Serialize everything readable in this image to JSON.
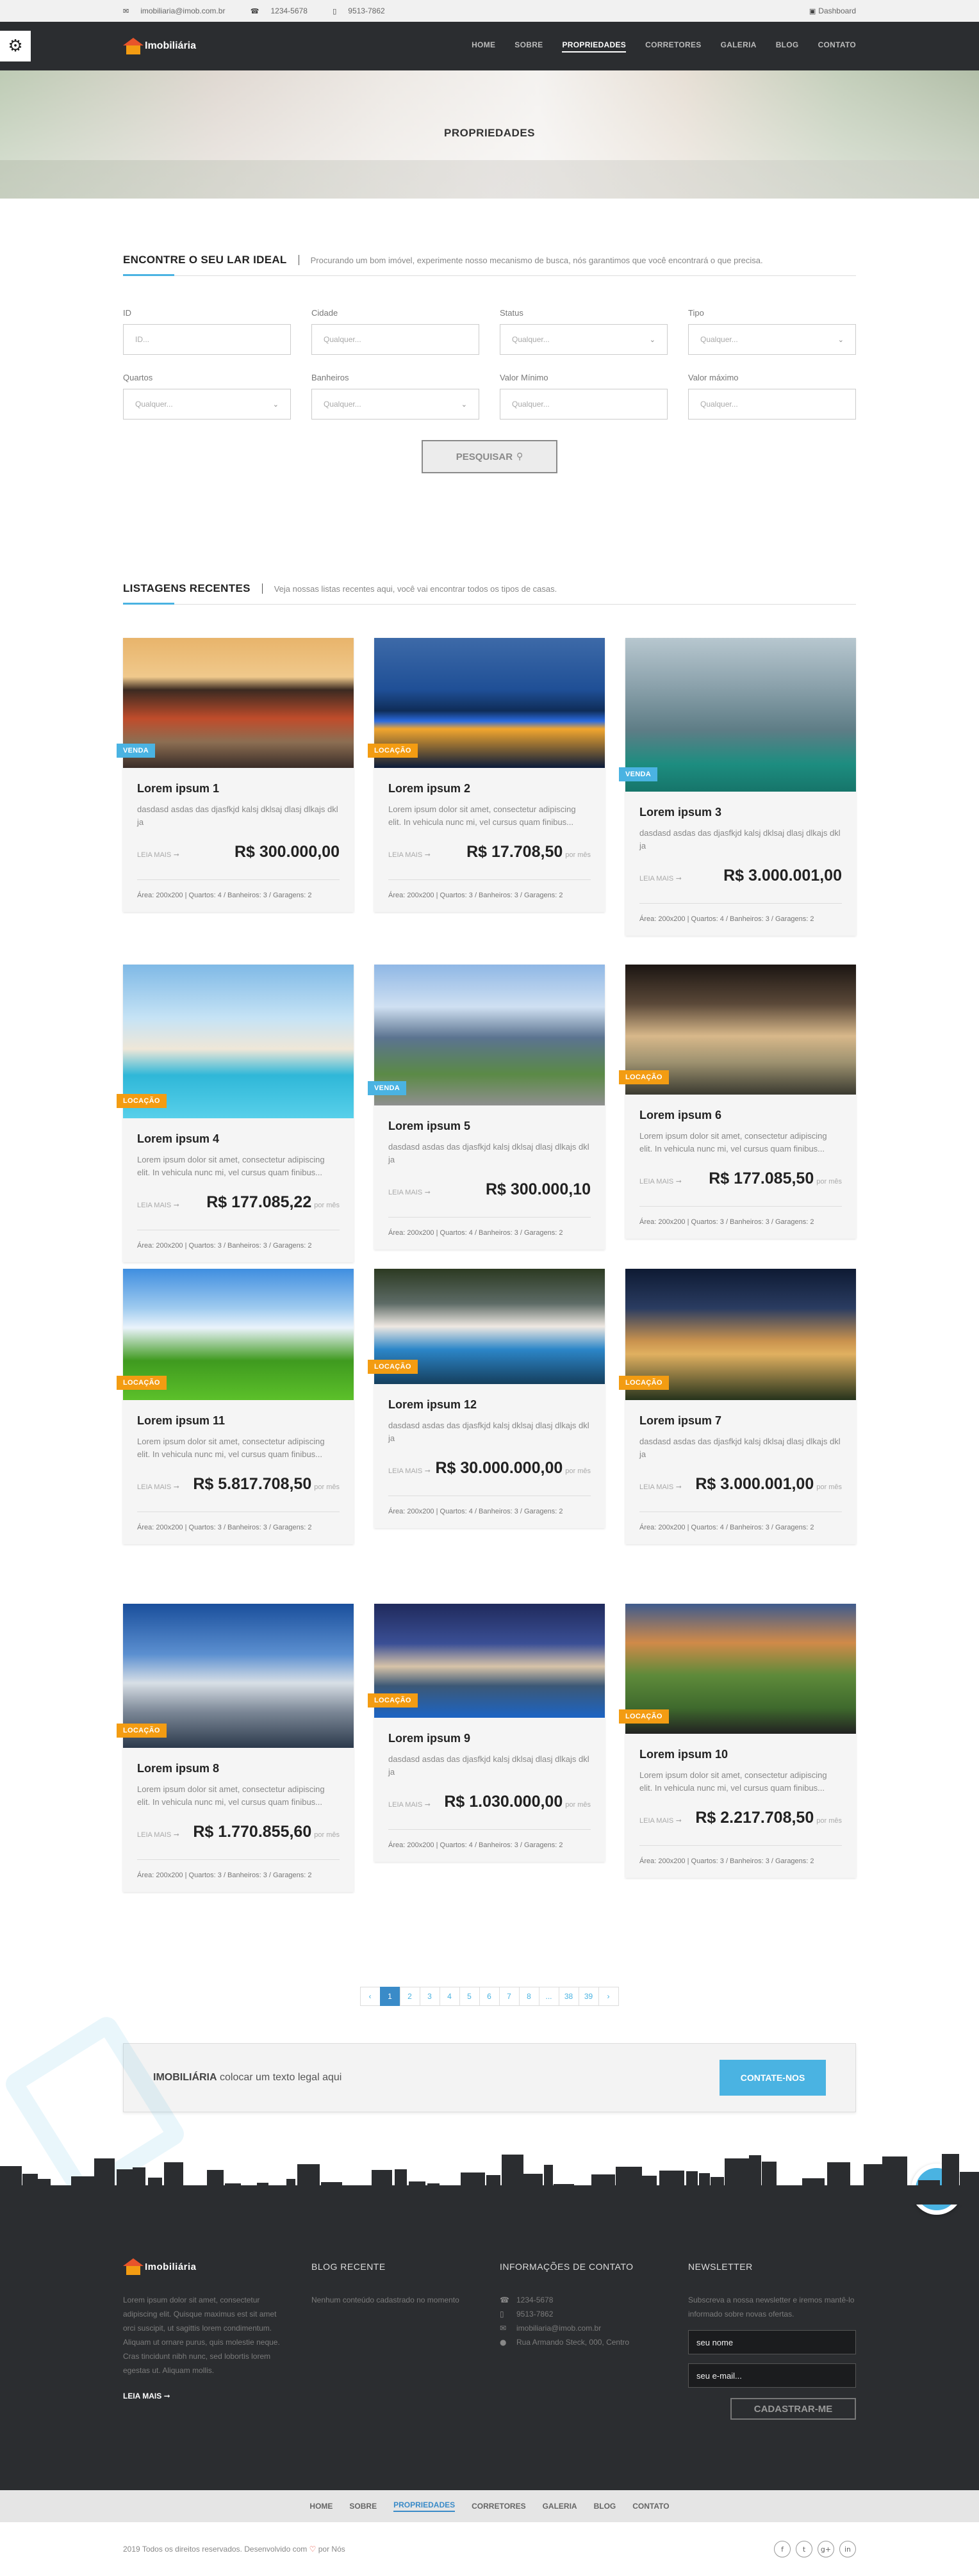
{
  "topbar": {
    "email": "imobiliaria@imob.com.br",
    "phone1": "1234-5678",
    "phone2": "9513-7862",
    "dashboard": "Dashboard"
  },
  "brand": {
    "name": "Imobiliária"
  },
  "nav": {
    "items": [
      "HOME",
      "SOBRE",
      "PROPRIEDADES",
      "CORRETORES",
      "GALERIA",
      "BLOG",
      "CONTATO"
    ],
    "active": "PROPRIEDADES"
  },
  "banner": {
    "title": "PROPRIEDADES"
  },
  "search": {
    "title": "ENCONTRE O SEU LAR IDEAL",
    "subtitle": "Procurando um bom imóvel, experimente nosso mecanismo de busca, nós garantimos que você encontrará o que precisa.",
    "fields": [
      {
        "label": "ID",
        "placeholder": "ID...",
        "select": false
      },
      {
        "label": "Cidade",
        "placeholder": "Qualquer...",
        "select": false
      },
      {
        "label": "Status",
        "placeholder": "Qualquer...",
        "select": true
      },
      {
        "label": "Tipo",
        "placeholder": "Qualquer...",
        "select": true
      },
      {
        "label": "Quartos",
        "placeholder": "Qualquer...",
        "select": true
      },
      {
        "label": "Banheiros",
        "placeholder": "Qualquer...",
        "select": true
      },
      {
        "label": "Valor Mínimo",
        "placeholder": "Qualquer...",
        "select": false
      },
      {
        "label": "Valor máximo",
        "placeholder": "Qualquer...",
        "select": false
      }
    ],
    "button": "PESQUISAR"
  },
  "listings": {
    "title": "LISTAGENS RECENTES",
    "subtitle": "Veja nossas listas recentes aqui, você vai encontrar todos os tipos de casas.",
    "read_more": "LEIA MAIS",
    "per_month": "por mês",
    "cards": [
      {
        "title": "Lorem ipsum 1",
        "badge": "VENDA",
        "desc": "dasdasd asdas das djasfkjd kalsj dklsaj dlasj dlkajs dkl ja",
        "price": "R$ 300.000,00",
        "monthly": false,
        "meta": "Área: 200x200  |  Quartos: 4  /  Banheiros: 3  /  Garagens: 2"
      },
      {
        "title": "Lorem ipsum 2",
        "badge": "LOCAÇÃO",
        "desc": "Lorem ipsum dolor sit amet, consectetur adipiscing elit. In vehicula nunc mi, vel cursus quam finibus...",
        "price": "R$ 17.708,50",
        "monthly": true,
        "meta": "Área: 200x200  |  Quartos: 3  /  Banheiros: 3  /  Garagens: 2"
      },
      {
        "title": "Lorem ipsum 3",
        "badge": "VENDA",
        "desc": "dasdasd asdas das djasfkjd kalsj dklsaj dlasj dlkajs dkl ja",
        "price": "R$ 3.000.001,00",
        "monthly": false,
        "meta": "Área: 200x200  |  Quartos: 4  /  Banheiros: 3  /  Garagens: 2"
      },
      {
        "title": "Lorem ipsum 4",
        "badge": "LOCAÇÃO",
        "desc": "Lorem ipsum dolor sit amet, consectetur adipiscing elit. In vehicula nunc mi, vel cursus quam finibus...",
        "price": "R$ 177.085,22",
        "monthly": true,
        "meta": "Área: 200x200  |  Quartos: 3  /  Banheiros: 3  /  Garagens: 2"
      },
      {
        "title": "Lorem ipsum 5",
        "badge": "VENDA",
        "desc": "dasdasd asdas das djasfkjd kalsj dklsaj dlasj dlkajs dkl ja",
        "price": "R$ 300.000,10",
        "monthly": false,
        "meta": "Área: 200x200  |  Quartos: 4  /  Banheiros: 3  /  Garagens: 2"
      },
      {
        "title": "Lorem ipsum 6",
        "badge": "LOCAÇÃO",
        "desc": "Lorem ipsum dolor sit amet, consectetur adipiscing elit. In vehicula nunc mi, vel cursus quam finibus...",
        "price": "R$ 177.085,50",
        "monthly": true,
        "meta": "Área: 200x200  |  Quartos: 3  /  Banheiros: 3  /  Garagens: 2"
      },
      {
        "title": "Lorem ipsum 11",
        "badge": "LOCAÇÃO",
        "desc": "Lorem ipsum dolor sit amet, consectetur adipiscing elit. In vehicula nunc mi, vel cursus quam finibus...",
        "price": "R$ 5.817.708,50",
        "monthly": true,
        "meta": "Área: 200x200  |  Quartos: 3  /  Banheiros: 3  /  Garagens: 2"
      },
      {
        "title": "Lorem ipsum 12",
        "badge": "LOCAÇÃO",
        "desc": "dasdasd asdas das djasfkjd kalsj dklsaj dlasj dlkajs dkl ja",
        "price": "R$ 30.000.000,00",
        "monthly": true,
        "meta": "Área: 200x200  |  Quartos: 4  /  Banheiros: 3  /  Garagens: 2"
      },
      {
        "title": "Lorem ipsum 7",
        "badge": "LOCAÇÃO",
        "desc": "dasdasd asdas das djasfkjd kalsj dklsaj dlasj dlkajs dkl ja",
        "price": "R$ 3.000.001,00",
        "monthly": true,
        "meta": "Área: 200x200  |  Quartos: 4  /  Banheiros: 3  /  Garagens: 2"
      },
      {
        "title": "Lorem ipsum 8",
        "badge": "LOCAÇÃO",
        "desc": "Lorem ipsum dolor sit amet, consectetur adipiscing elit. In vehicula nunc mi, vel cursus quam finibus...",
        "price": "R$ 1.770.855,60",
        "monthly": true,
        "meta": "Área: 200x200  |  Quartos: 3  /  Banheiros: 3  /  Garagens: 2"
      },
      {
        "title": "Lorem ipsum 9",
        "badge": "LOCAÇÃO",
        "desc": "dasdasd asdas das djasfkjd kalsj dklsaj dlasj dlkajs dkl ja",
        "price": "R$ 1.030.000,00",
        "monthly": true,
        "meta": "Área: 200x200  |  Quartos: 4  /  Banheiros: 3  /  Garagens: 2"
      },
      {
        "title": "Lorem ipsum 10",
        "badge": "LOCAÇÃO",
        "desc": "Lorem ipsum dolor sit amet, consectetur adipiscing elit. In vehicula nunc mi, vel cursus quam finibus...",
        "price": "R$ 2.217.708,50",
        "monthly": true,
        "meta": "Área: 200x200  |  Quartos: 3  /  Banheiros: 3  /  Garagens: 2"
      }
    ]
  },
  "pagination": {
    "prev": "‹",
    "next": "›",
    "pages": [
      "1",
      "2",
      "3",
      "4",
      "5",
      "6",
      "7",
      "8",
      "...",
      "38",
      "39"
    ],
    "active": "1"
  },
  "cta": {
    "brand": "IMOBILIÁRIA",
    "text": "colocar um texto legal aqui",
    "button": "CONTATE-NOS"
  },
  "footer": {
    "about": "Lorem ipsum dolor sit amet, consectetur adipiscing elit. Quisque maximus est sit amet orci suscipit, ut sagittis lorem condimentum. Aliquam ut ornare purus, quis molestie neque. Cras tincidunt nibh nunc, sed lobortis lorem egestas ut. Aliquam mollis.",
    "read_more": "LEIA MAIS",
    "blog_title": "BLOG RECENTE",
    "blog_empty": "Nenhum conteúdo cadastrado no momento",
    "contact_title": "INFORMAÇÕES DE CONTATO",
    "contact": {
      "phone1": "1234-5678",
      "phone2": "9513-7862",
      "email": "imobiliaria@imob.com.br",
      "address": "Rua Armando Steck, 000, Centro"
    },
    "newsletter_title": "NEWSLETTER",
    "newsletter_text": "Subscreva a nossa newsletter e iremos mantê-lo informado sobre novas ofertas.",
    "name_placeholder": "seu nome",
    "email_placeholder": "seu e-mail...",
    "button": "CADASTRAR-ME"
  },
  "bottom_nav": [
    "HOME",
    "SOBRE",
    "PROPRIEDADES",
    "CORRETORES",
    "GALERIA",
    "BLOG",
    "CONTATO"
  ],
  "copyright": {
    "before": "2019 Todos os direitos reservados. Desenvolvido com",
    "after": "por Nós"
  },
  "socials": [
    "f",
    "t",
    "g+",
    "in"
  ],
  "colors": {
    "accent": "#4ab3e2",
    "rent": "#f39c12",
    "dark": "#2b2d30",
    "active_page": "#3a8bc8"
  }
}
